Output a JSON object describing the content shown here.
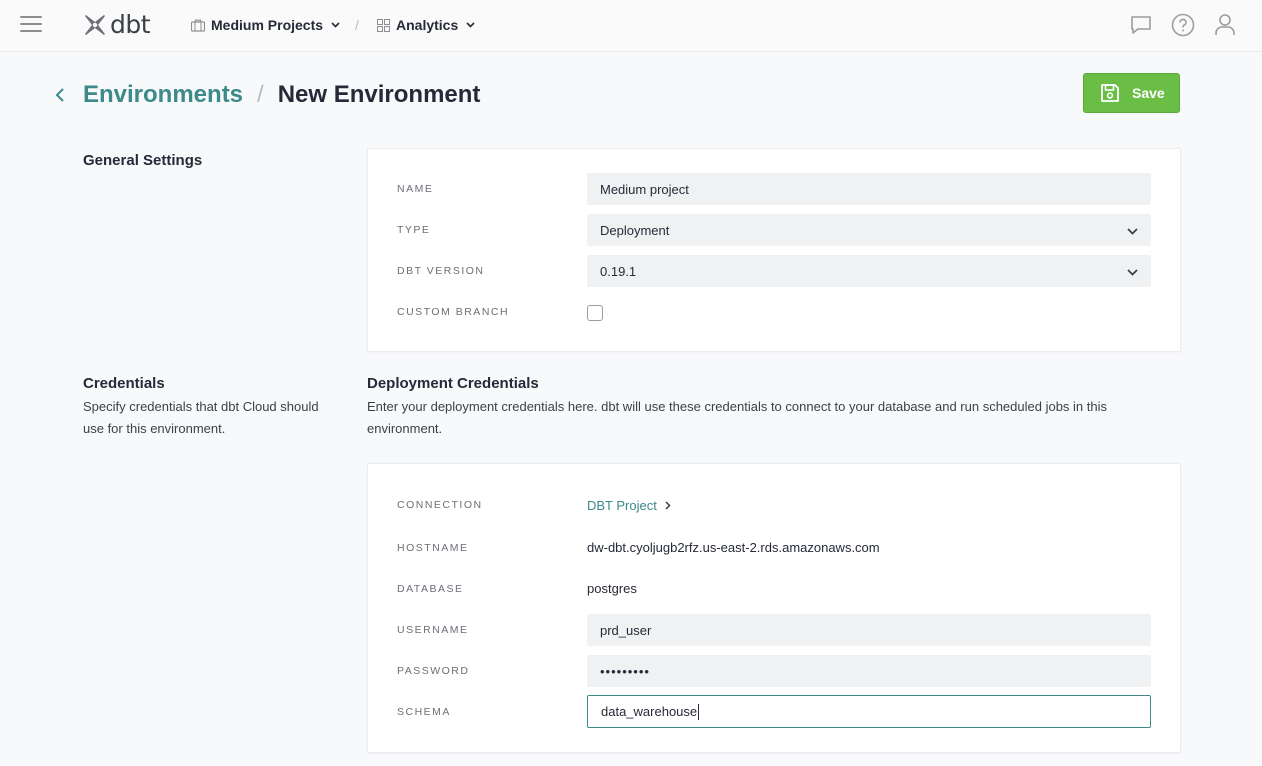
{
  "topbar": {
    "logo_text": "dbt",
    "account_label": "Medium Projects",
    "breadcrumb_sep": "/",
    "project_label": "Analytics"
  },
  "header": {
    "back_link": "Environments",
    "separator": "/",
    "title": "New Environment",
    "save_label": "Save"
  },
  "general": {
    "section_title": "General Settings",
    "name_label": "NAME",
    "name_value": "Medium project",
    "type_label": "TYPE",
    "type_value": "Deployment",
    "version_label": "DBT VERSION",
    "version_value": "0.19.1",
    "custom_branch_label": "CUSTOM BRANCH",
    "custom_branch_checked": false
  },
  "credentials": {
    "section_title": "Credentials",
    "section_desc": "Specify credentials that dbt Cloud should use for this environment.",
    "deploy_title": "Deployment Credentials",
    "deploy_desc": "Enter your deployment credentials here. dbt will use these credentials to connect to your database and run scheduled jobs in this environment.",
    "connection_label": "CONNECTION",
    "connection_value": "DBT Project",
    "hostname_label": "HOSTNAME",
    "hostname_value": "dw-dbt.cyoljugb2rfz.us-east-2.rds.amazonaws.com",
    "database_label": "DATABASE",
    "database_value": "postgres",
    "username_label": "USERNAME",
    "username_value": "prd_user",
    "password_label": "PASSWORD",
    "password_value": "•••••••••",
    "schema_label": "SCHEMA",
    "schema_value": "data_warehouse"
  },
  "colors": {
    "accent": "#3c8a8a",
    "save_green": "#6abd45",
    "text": "#262a38"
  },
  "icons": [
    "hamburger-icon",
    "dbt-logo-icon",
    "briefcase-icon",
    "chevron-down-icon",
    "grid-icon",
    "chat-icon",
    "help-icon",
    "user-icon",
    "back-chevron-icon",
    "save-disk-icon",
    "chevron-right-icon"
  ]
}
